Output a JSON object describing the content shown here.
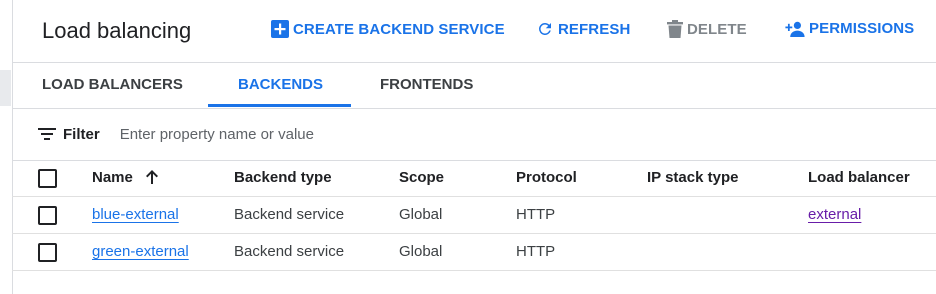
{
  "header": {
    "title": "Load balancing",
    "actions": {
      "create": "CREATE BACKEND SERVICE",
      "refresh": "REFRESH",
      "delete": "DELETE",
      "permissions": "PERMISSIONS"
    }
  },
  "tabs": [
    {
      "label": "LOAD BALANCERS",
      "active": false
    },
    {
      "label": "BACKENDS",
      "active": true
    },
    {
      "label": "FRONTENDS",
      "active": false
    }
  ],
  "filter": {
    "label": "Filter",
    "placeholder": "Enter property name or value"
  },
  "table": {
    "columns": [
      "Name",
      "Backend type",
      "Scope",
      "Protocol",
      "IP stack type",
      "Load balancer"
    ],
    "sort": {
      "column": "Name",
      "direction": "ascending"
    },
    "rows": [
      {
        "name": "blue-external",
        "backend_type": "Backend service",
        "scope": "Global",
        "protocol": "HTTP",
        "ip_stack_type": "",
        "load_balancer": "external"
      },
      {
        "name": "green-external",
        "backend_type": "Backend service",
        "scope": "Global",
        "protocol": "HTTP",
        "ip_stack_type": "",
        "load_balancer": ""
      }
    ]
  },
  "colors": {
    "accent": "#1a73e8",
    "visited_link": "#681da8",
    "disabled": "#80868b",
    "divider": "#dadce0"
  },
  "icons": {
    "create": "add-box-icon",
    "refresh": "refresh-icon",
    "delete": "trash-icon",
    "permissions": "person-add-icon",
    "filter": "filter-lines-icon",
    "sort": "arrow-up-icon"
  }
}
